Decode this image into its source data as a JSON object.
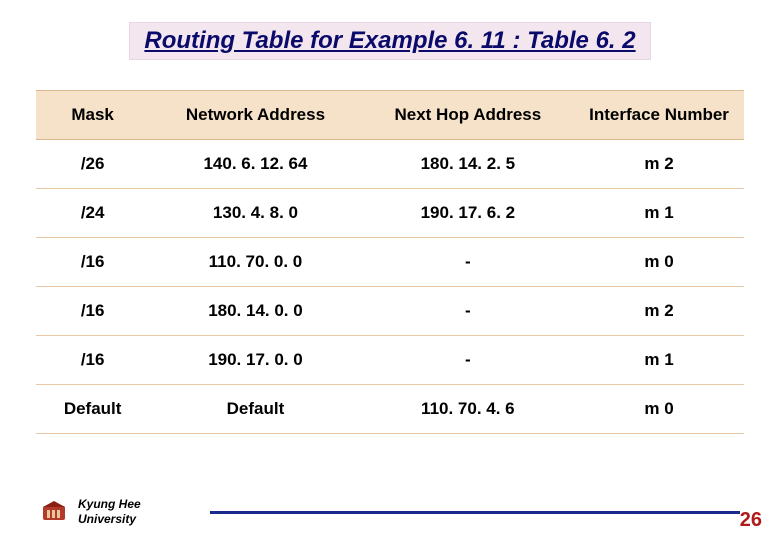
{
  "title": "Routing Table for Example 6. 11 : Table 6. 2",
  "table": {
    "headers": [
      "Mask",
      "Network Address",
      "Next Hop Address",
      "Interface Number"
    ],
    "rows": [
      {
        "mask": "/26",
        "network": "140. 6. 12. 64",
        "nexthop": "180. 14. 2. 5",
        "iface": "m 2"
      },
      {
        "mask": "/24",
        "network": "130. 4. 8. 0",
        "nexthop": "190. 17. 6. 2",
        "iface": "m 1"
      },
      {
        "mask": "/16",
        "network": "110. 70. 0. 0",
        "nexthop": "-",
        "iface": "m 0"
      },
      {
        "mask": "/16",
        "network": "180. 14. 0. 0",
        "nexthop": "-",
        "iface": "m 2"
      },
      {
        "mask": "/16",
        "network": "190. 17. 0. 0",
        "nexthop": "-",
        "iface": "m 1"
      },
      {
        "mask": "Default",
        "network": "Default",
        "nexthop": "110. 70. 4. 6",
        "iface": "m 0"
      }
    ]
  },
  "footer": {
    "university_line1": "Kyung Hee",
    "university_line2": "University",
    "page_number": "26"
  },
  "icons": {
    "logo": "university-crest-icon"
  }
}
